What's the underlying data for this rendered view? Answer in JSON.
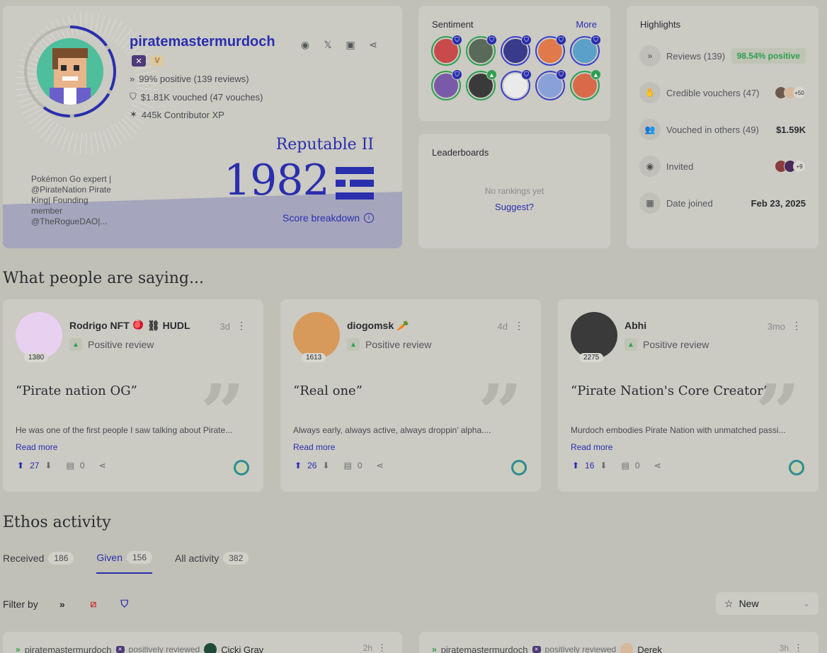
{
  "profile": {
    "username": "piratemastermurdoch",
    "positive": "99% positive (139 reviews)",
    "vouched": "$1.81K vouched (47 vouches)",
    "xp": "445k Contributor XP",
    "bio": "Pokémon Go expert | @PirateNation Pirate King| Founding member @TheRogueDAO|...",
    "level": "Reputable II",
    "score": "1982",
    "score_breakdown": "Score breakdown",
    "social_icons": [
      "discord-icon",
      "x-icon",
      "wallet-icon",
      "share-icon"
    ],
    "accent_color": "#2a2fae"
  },
  "sentiment": {
    "title": "Sentiment",
    "more": "More"
  },
  "leaderboards": {
    "title": "Leaderboards",
    "empty": "No rankings yet",
    "suggest": "Suggest?"
  },
  "highlights": {
    "title": "Highlights",
    "reviews_label": "Reviews (139)",
    "reviews_badge": "98.54% positive",
    "credible_label": "Credible vouchers (47)",
    "credible_more": "+50",
    "vouched_label": "Vouched in others (49)",
    "vouched_value": "$1.59K",
    "invited_label": "Invited",
    "invited_more": "+9",
    "joined_label": "Date joined",
    "joined_value": "Feb 23, 2025"
  },
  "sections": {
    "saying": "What people are saying...",
    "activity": "Ethos activity"
  },
  "reviews": [
    {
      "name": "Rodrigo NFT 🪀 ⛓ HUDL",
      "time": "3d",
      "type": "Positive review",
      "score": "1380",
      "title": "“Pirate nation OG”",
      "text": "He was one of the first people I saw talking about Pirate...",
      "read_more": "Read more",
      "upvotes": "27",
      "comments": "0"
    },
    {
      "name": "diogomsk 🥕",
      "time": "4d",
      "type": "Positive review",
      "score": "1613",
      "title": "“Real one”",
      "text": "Always early, always active, always droppin’ alpha....",
      "read_more": "Read more",
      "upvotes": "26",
      "comments": "0"
    },
    {
      "name": "Abhi",
      "time": "3mo",
      "type": "Positive review",
      "score": "2275",
      "title": "“Pirate Nation's Core Creator”",
      "text": "Murdoch embodies Pirate Nation with unmatched passi...",
      "read_more": "Read more",
      "upvotes": "16",
      "comments": "0"
    }
  ],
  "tabs": [
    {
      "label": "Received",
      "count": "186"
    },
    {
      "label": "Given",
      "count": "156"
    },
    {
      "label": "All activity",
      "count": "382"
    }
  ],
  "filter": {
    "label": "Filter by",
    "sort": "New"
  },
  "activity": [
    {
      "user": "piratemastermurdoch",
      "verb": "positively reviewed",
      "target": "Cicki Grav",
      "time": "2h"
    },
    {
      "user": "piratemastermurdoch",
      "verb": "positively reviewed",
      "target": "Derek",
      "time": "3h"
    }
  ]
}
